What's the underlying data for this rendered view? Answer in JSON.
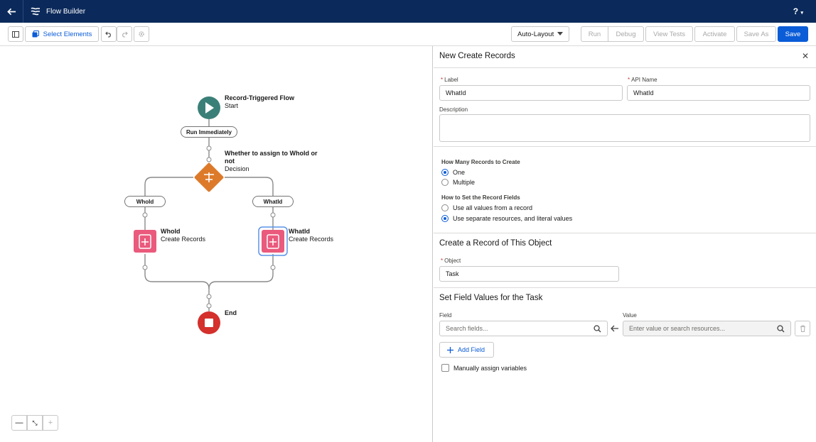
{
  "app": {
    "title": "Flow Builder",
    "help": "?"
  },
  "toolbar": {
    "select_elements": "Select Elements",
    "layout": "Auto-Layout",
    "run": "Run",
    "debug": "Debug",
    "view_tests": "View Tests",
    "activate": "Activate",
    "save_as": "Save As",
    "save": "Save"
  },
  "canvas": {
    "start": {
      "title": "Record-Triggered Flow",
      "subtitle": "Start"
    },
    "run_immediately": "Run Immediately",
    "decision": {
      "title": "Whether to assign to WhoId or not",
      "subtitle": "Decision"
    },
    "branches": [
      "WhoId",
      "WhatId"
    ],
    "records": [
      {
        "title": "WhoId",
        "subtitle": "Create Records"
      },
      {
        "title": "WhatId",
        "subtitle": "Create Records"
      }
    ],
    "end": "End"
  },
  "panel": {
    "title": "New Create Records",
    "label_label": "Label",
    "label_value": "WhatId",
    "api_label": "API Name",
    "api_value": "WhatId",
    "description_label": "Description",
    "how_many_label": "How Many Records to Create",
    "how_many_options": [
      "One",
      "Multiple"
    ],
    "how_set_label": "How to Set the Record Fields",
    "how_set_options": [
      "Use all values from a record",
      "Use separate resources, and literal values"
    ],
    "create_section": "Create a Record of This Object",
    "object_label": "Object",
    "object_value": "Task",
    "set_fields_section": "Set Field Values for the Task",
    "field_label": "Field",
    "field_placeholder": "Search fields...",
    "value_label": "Value",
    "value_placeholder": "Enter value or search resources...",
    "add_field": "Add Field",
    "manual_assign": "Manually assign variables"
  },
  "colors": {
    "header": "#0b2a5b",
    "start": "#3b8078",
    "decision": "#dd7a2a",
    "create": "#ea5a7c",
    "end": "#d4302c",
    "accent": "#0b5cd7"
  }
}
